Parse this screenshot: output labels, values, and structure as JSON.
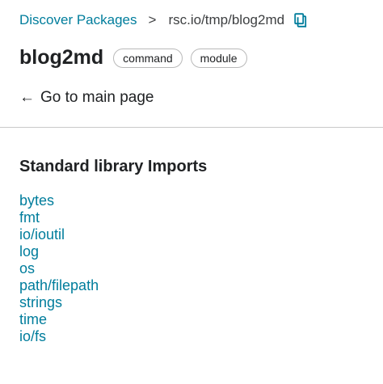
{
  "breadcrumb": {
    "root_label": "Discover Packages",
    "separator": ">",
    "current": "rsc.io/tmp/blog2md",
    "copy_icon": "copy-icon"
  },
  "header": {
    "title": "blog2md",
    "badges": [
      "command",
      "module"
    ]
  },
  "back_link": {
    "arrow": "←",
    "label": "Go to main page"
  },
  "imports": {
    "heading": "Standard library Imports",
    "items": [
      "bytes",
      "fmt",
      "io/ioutil",
      "log",
      "os",
      "path/filepath",
      "strings",
      "time",
      "io/fs"
    ]
  },
  "colors": {
    "link": "#007d9c",
    "text": "#202224",
    "divider": "#c9c9c9"
  }
}
